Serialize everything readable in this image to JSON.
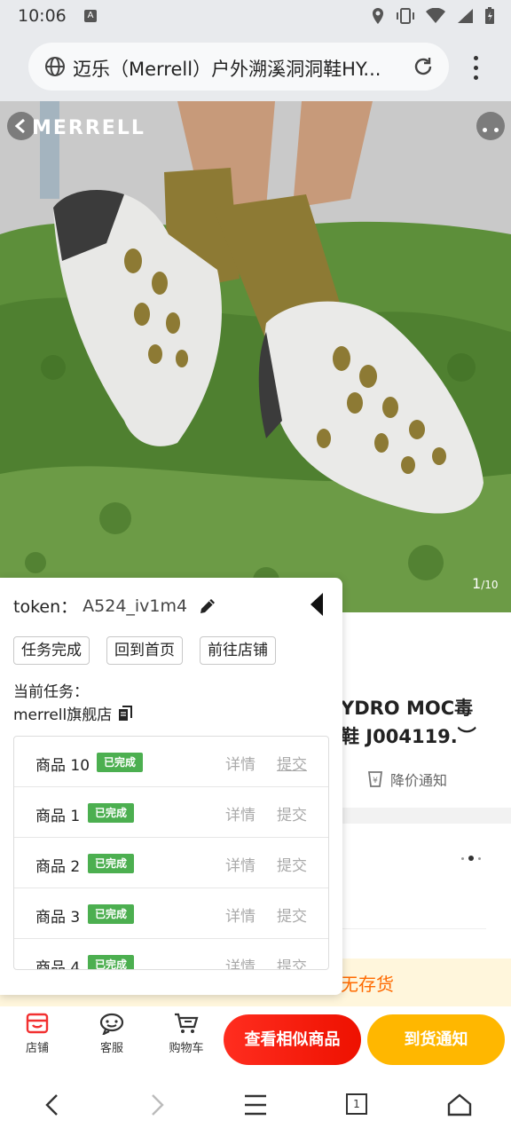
{
  "status_bar": {
    "time": "10:06",
    "notification_badge": "A"
  },
  "browser": {
    "url_title": "迈乐（Merrell）户外溯溪洞洞鞋HY..."
  },
  "hero": {
    "brand": "MERRELL",
    "image_index": "1",
    "image_total": "/10"
  },
  "product": {
    "title_line1": "YDRO MOC毒",
    "title_line2": "鞋 J004119.︶",
    "price_notice": "降价通知",
    "stock_status": "无存货"
  },
  "action_bar": {
    "store": "店铺",
    "service": "客服",
    "cart": "购物车",
    "similar_button": "查看相似商品",
    "notify_button": "到货通知"
  },
  "bottom_nav": {
    "tab_count": "1"
  },
  "task_panel": {
    "token_label": "token：",
    "token_value": "A524_iv1m4",
    "buttons": [
      "任务完成",
      "回到首页",
      "前往店铺"
    ],
    "current_task_label": "当前任务：",
    "current_store": "merrell旗舰店",
    "done_label": "已完成",
    "detail_label": "详情",
    "submit_label": "提交",
    "tasks": [
      {
        "name": "商品 10"
      },
      {
        "name": "商品 1"
      },
      {
        "name": "商品 2"
      },
      {
        "name": "商品 3"
      },
      {
        "name": "商品 4"
      }
    ]
  }
}
